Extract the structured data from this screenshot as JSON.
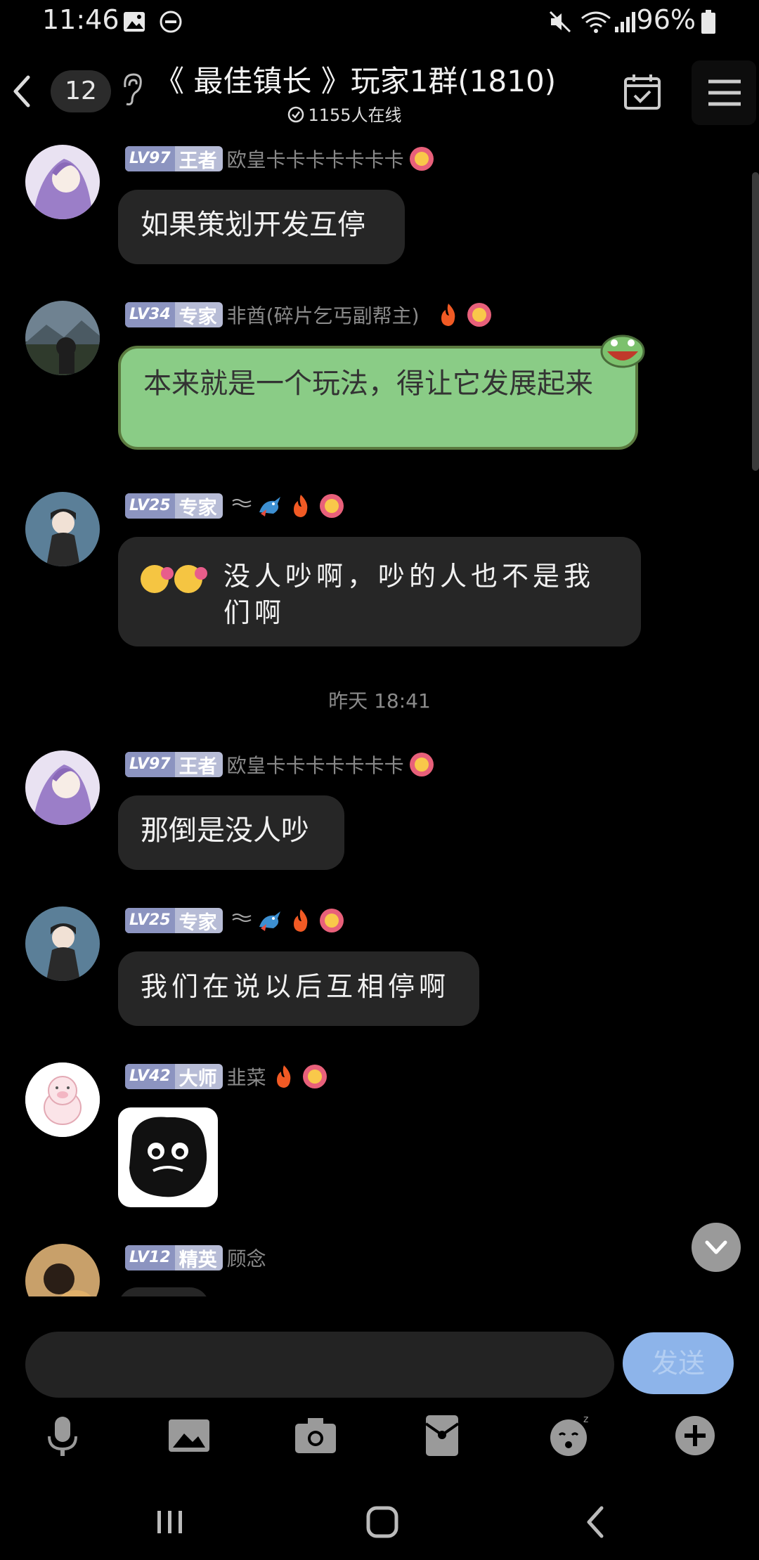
{
  "status_bar": {
    "time": "11:46",
    "battery": "96%"
  },
  "header": {
    "unread_count": "12",
    "title": "《 最佳镇长 》玩家1群(1810)",
    "online": "1155人在线"
  },
  "messages": [
    {
      "level": "LV97",
      "rank": "王者",
      "nickname": "欧皇卡卡卡卡卡卡卡",
      "text": "如果策划开发互停"
    },
    {
      "level": "LV34",
      "rank": "专家",
      "nickname": "非酋(碎片乞丐副帮主)",
      "text": "本来就是一个玩法，得让它发展起来"
    },
    {
      "level": "LV25",
      "rank": "专家",
      "nickname": "",
      "text": "没人吵啊，吵的人也不是我们啊"
    },
    {
      "level": "LV97",
      "rank": "王者",
      "nickname": "欧皇卡卡卡卡卡卡卡",
      "text": "那倒是没人吵"
    },
    {
      "level": "LV25",
      "rank": "专家",
      "nickname": "",
      "text": "我们在说以后互相停啊"
    },
    {
      "level": "LV42",
      "rank": "大师",
      "nickname": "韭菜",
      "text": ""
    },
    {
      "level": "LV12",
      "rank": "精英",
      "nickname": "顾念",
      "text": ""
    }
  ],
  "time_divider": "昨天 18:41",
  "composer": {
    "placeholder": "",
    "send_label": "发送"
  },
  "colors": {
    "green_bubble": "#8acc86",
    "dark_bubble": "#262626",
    "level_badge": "#b7bcd6",
    "send_button": "#8db4ea"
  }
}
